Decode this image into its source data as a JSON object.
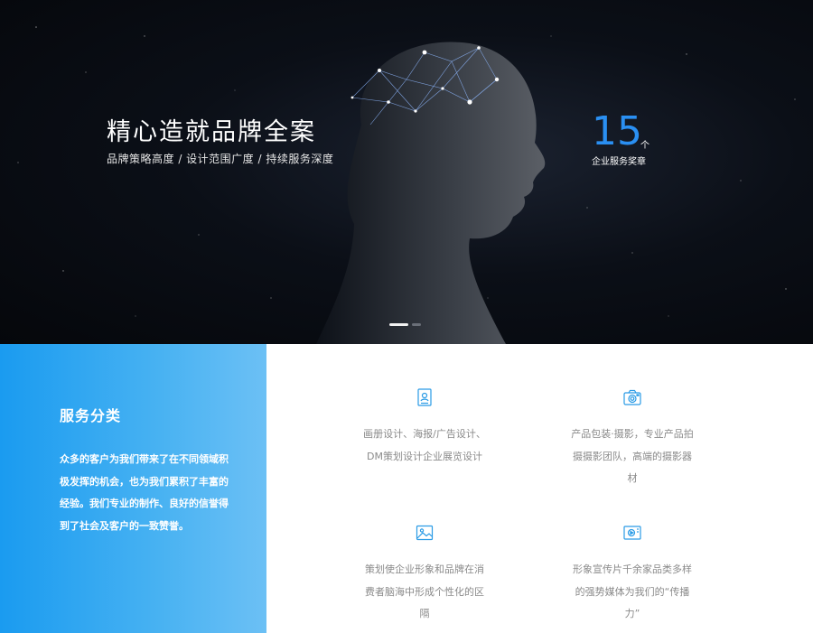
{
  "hero": {
    "title": "精心造就品牌全案",
    "subtitle": "品牌策略高度 / 设计范围广度 / 持续服务深度",
    "stat_value": "15",
    "stat_unit": "个",
    "stat_label": "企业服务奖章",
    "slides_count": 2,
    "active_slide": 1
  },
  "left_panel": {
    "title": "服务分类",
    "description": "众多的客户为我们带来了在不同领域积极发挥的机会，也为我们累积了丰富的经验。我们专业的制作、良好的信誉得到了社会及客户的一致赞誉。"
  },
  "services": [
    {
      "icon": "id-card-icon",
      "text": "画册设计、海报/广告设计、DM策划设计企业展览设计"
    },
    {
      "icon": "camera-icon",
      "text": "产品包装·摄影，专业产品拍摄摄影团队，高端的摄影器材"
    },
    {
      "icon": "image-icon",
      "text": "策划使企业形象和品牌在消费者脑海中形成个性化的区隔"
    },
    {
      "icon": "media-icon",
      "text": "形象宣传片千余家品类多样的强势媒体为我们的“传播力”"
    }
  ],
  "colors": {
    "accent": "#2a8ff2",
    "panel_gradient_start": "#1a9bf0",
    "panel_gradient_end": "#6cc0f5",
    "service_text": "#8a8a8a",
    "icon": "#2a9be6"
  }
}
